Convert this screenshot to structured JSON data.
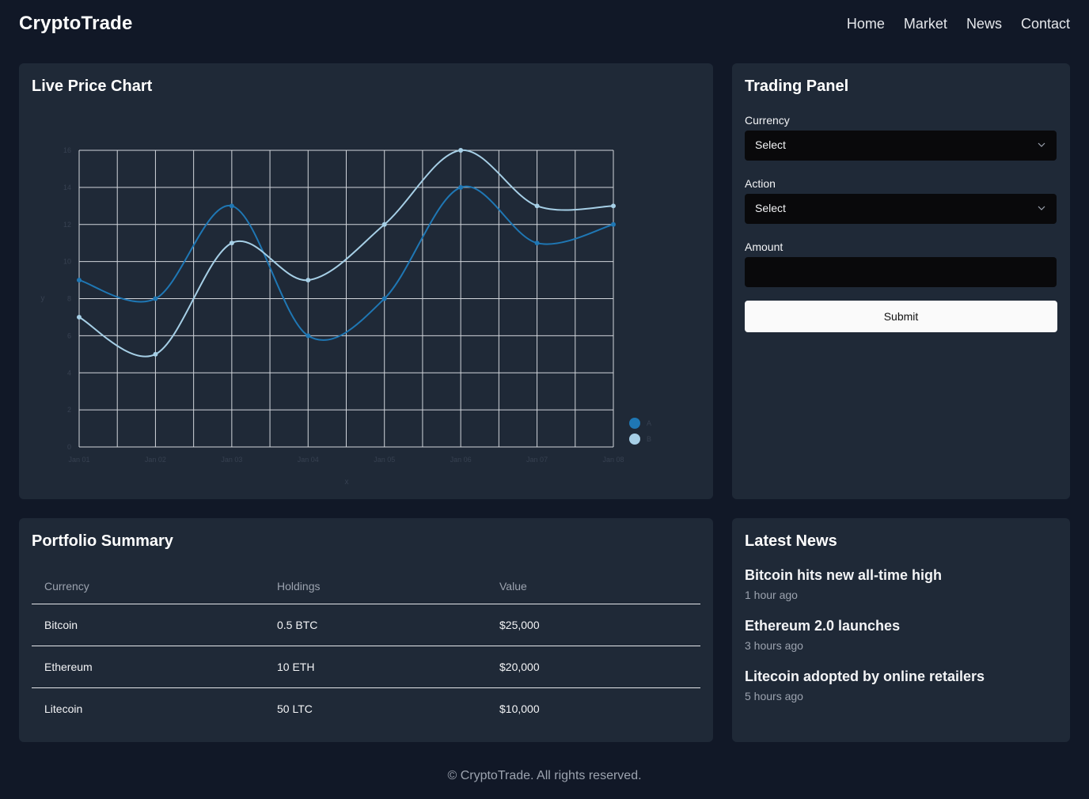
{
  "header": {
    "brand": "CryptoTrade",
    "nav": [
      "Home",
      "Market",
      "News",
      "Contact"
    ]
  },
  "chart_card": {
    "title": "Live Price Chart"
  },
  "chart_data": {
    "type": "line",
    "title": "",
    "xlabel": "x",
    "ylabel": "y",
    "categories": [
      "Jan 01",
      "Jan 02",
      "Jan 03",
      "Jan 04",
      "Jan 05",
      "Jan 06",
      "Jan 07",
      "Jan 08"
    ],
    "ylim": [
      0,
      16
    ],
    "yticks": [
      0,
      2,
      4,
      6,
      8,
      10,
      12,
      14,
      16
    ],
    "grid": true,
    "legend_position": "right-bottom",
    "series": [
      {
        "name": "A",
        "color": "#1f77b4",
        "values": [
          9,
          8,
          13,
          6,
          8,
          14,
          11,
          12
        ]
      },
      {
        "name": "B",
        "color": "#a6cfe6",
        "values": [
          7,
          5,
          11,
          9,
          12,
          16,
          13,
          13
        ]
      }
    ]
  },
  "trading_panel": {
    "title": "Trading Panel",
    "currency_label": "Currency",
    "currency_value": "Select",
    "action_label": "Action",
    "action_value": "Select",
    "amount_label": "Amount",
    "amount_value": "",
    "submit_label": "Submit"
  },
  "portfolio": {
    "title": "Portfolio Summary",
    "columns": [
      "Currency",
      "Holdings",
      "Value"
    ],
    "rows": [
      [
        "Bitcoin",
        "0.5 BTC",
        "$25,000"
      ],
      [
        "Ethereum",
        "10 ETH",
        "$20,000"
      ],
      [
        "Litecoin",
        "50 LTC",
        "$10,000"
      ]
    ]
  },
  "news": {
    "title": "Latest News",
    "items": [
      {
        "headline": "Bitcoin hits new all-time high",
        "time": "1 hour ago"
      },
      {
        "headline": "Ethereum 2.0 launches",
        "time": "3 hours ago"
      },
      {
        "headline": "Litecoin adopted by online retailers",
        "time": "5 hours ago"
      }
    ]
  },
  "footer": {
    "text": "© CryptoTrade. All rights reserved."
  }
}
